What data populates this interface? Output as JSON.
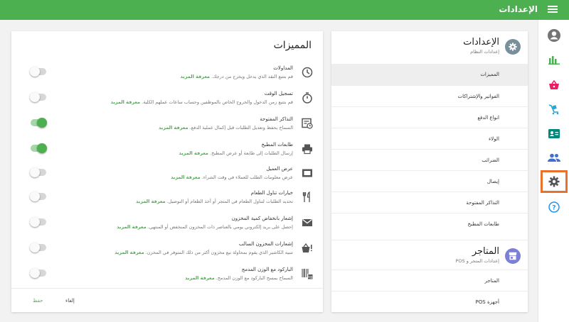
{
  "header": {
    "title": "الإعدادات"
  },
  "colors": {
    "accent": "#4caf50",
    "highlight": "#e8722c",
    "store_icon": "#7c7fd6"
  },
  "rail": [
    "account-icon",
    "chart-icon",
    "basket-icon",
    "cart-icon",
    "contact-card-icon",
    "people-icon",
    "gear-icon",
    "help-icon"
  ],
  "features": {
    "title": "المميزات",
    "items": [
      {
        "name": "المداولات",
        "desc": "قم بتتبع النقد الذي يدخل ويخرج من درجك",
        "more": "معرفة المزيد",
        "enabled": false,
        "icon": "clock-icon"
      },
      {
        "name": "تسجيل الوقت",
        "desc": "قم بتتبع زمن الدخول والخروج الخاص بالموظفين وحساب ساعات عملهم الكلية",
        "more": "معرفة المزيد",
        "enabled": false,
        "icon": "timer-icon"
      },
      {
        "name": "التذاكر المفتوحة",
        "desc": "السماح بحفظ وتعديل الطلبات قبل إكمال عملية الدفع",
        "more": "معرفة المزيد",
        "enabled": true,
        "icon": "ticket-clock-icon"
      },
      {
        "name": "طابعات المطبخ",
        "desc": "إرسال الطلبات إلى طابعة أو عرض المطبخ",
        "more": "معرفة المزيد",
        "enabled": true,
        "icon": "printer-icon"
      },
      {
        "name": "عرض العميل",
        "desc": "عرض معلومات الطلب للعملاء في وقت الشراء",
        "more": "معرفة المزيد",
        "enabled": false,
        "icon": "display-icon"
      },
      {
        "name": "خيارات تناول الطعام",
        "desc": "تحديد الطلبات لتناول الطعام في المتجر أو أخذ الطعام أو التوصيل",
        "more": "معرفة المزيد",
        "enabled": false,
        "icon": "cutlery-icon"
      },
      {
        "name": "إشعار بانخفاض كمية المخزون",
        "desc": "إحصل على بريد إلكتروني يومي بالعناصر ذات المخزون المنخفض أو المنتهي",
        "more": "معرفة المزيد",
        "enabled": false,
        "icon": "mail-icon"
      },
      {
        "name": "إشعارات المخزون السالب",
        "desc": "تنبيه الكاشير الذي يقوم بمحاولة بيع مخزون أكثر من ذلك المتوفر في المخزن",
        "more": "معرفة المزيد",
        "enabled": false,
        "icon": "basket-alert-icon"
      },
      {
        "name": "الباركود مع الوزن المدمج",
        "desc": "السماح بمسح الباركود مع الوزن المدمج",
        "more": "معرفة المزيد",
        "enabled": false,
        "icon": "barcode-scale-icon"
      }
    ],
    "cancel_label": "إلغاء",
    "save_label": "حفظ"
  },
  "settings": {
    "system": {
      "title": "الإعدادات",
      "subtitle": "إعدادات النظام",
      "items": [
        "المميزات",
        "الفواتير والإشتراكات",
        "انواع الدفع",
        "الولاء",
        "الضرائب",
        "إيصال",
        "التذاكر المفتوحة",
        "طابعات المطبخ"
      ],
      "active_index": 0
    },
    "stores": {
      "title": "المتاجر",
      "subtitle": "إعدادات المتجر و POS",
      "items": [
        "المتاجر",
        "أجهزة POS"
      ]
    }
  }
}
